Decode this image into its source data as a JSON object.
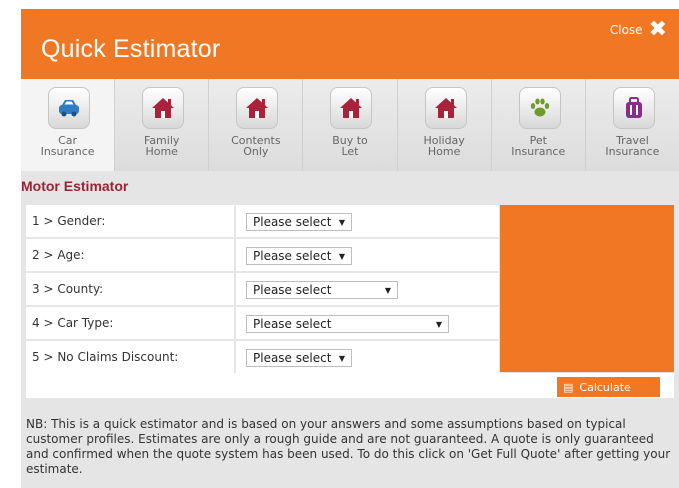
{
  "header": {
    "title": "Quick Estimator",
    "close_label": "Close"
  },
  "tabs": [
    {
      "label": "Car\nInsurance",
      "icon": "car-icon",
      "active": true
    },
    {
      "label": "Family\nHome",
      "icon": "house-icon"
    },
    {
      "label": "Contents\nOnly",
      "icon": "house-icon"
    },
    {
      "label": "Buy to\nLet",
      "icon": "house-icon"
    },
    {
      "label": "Holiday\nHome",
      "icon": "house-icon"
    },
    {
      "label": "Pet\nInsurance",
      "icon": "paw-icon"
    },
    {
      "label": "Travel\nInsurance",
      "icon": "luggage-icon"
    }
  ],
  "section_title": "Motor Estimator",
  "form": {
    "rows": [
      {
        "label": "1 > Gender:",
        "value": "Please select"
      },
      {
        "label": "2 > Age:",
        "value": "Please select"
      },
      {
        "label": "3 > County:",
        "value": "Please select"
      },
      {
        "label": "4 > Car Type:",
        "value": "Please select"
      },
      {
        "label": "5 > No Claims Discount:",
        "value": "Please select"
      }
    ]
  },
  "calculate_label": "Calculate",
  "note": "NB: This is a quick estimator and is based on your answers and some assumptions based on typical customer profiles. Estimates are only a rough guide and are not guaranteed. A quote is only guaranteed and confirmed when the quote system has been used. To do this click on 'Get Full Quote' after getting your estimate.",
  "colors": {
    "accent": "#f07724",
    "title_red": "#9b2434",
    "icon_red": "#a8233a",
    "icon_blue": "#2f7cc4",
    "icon_green": "#6f9a2c",
    "icon_purple": "#8b2b8e"
  }
}
